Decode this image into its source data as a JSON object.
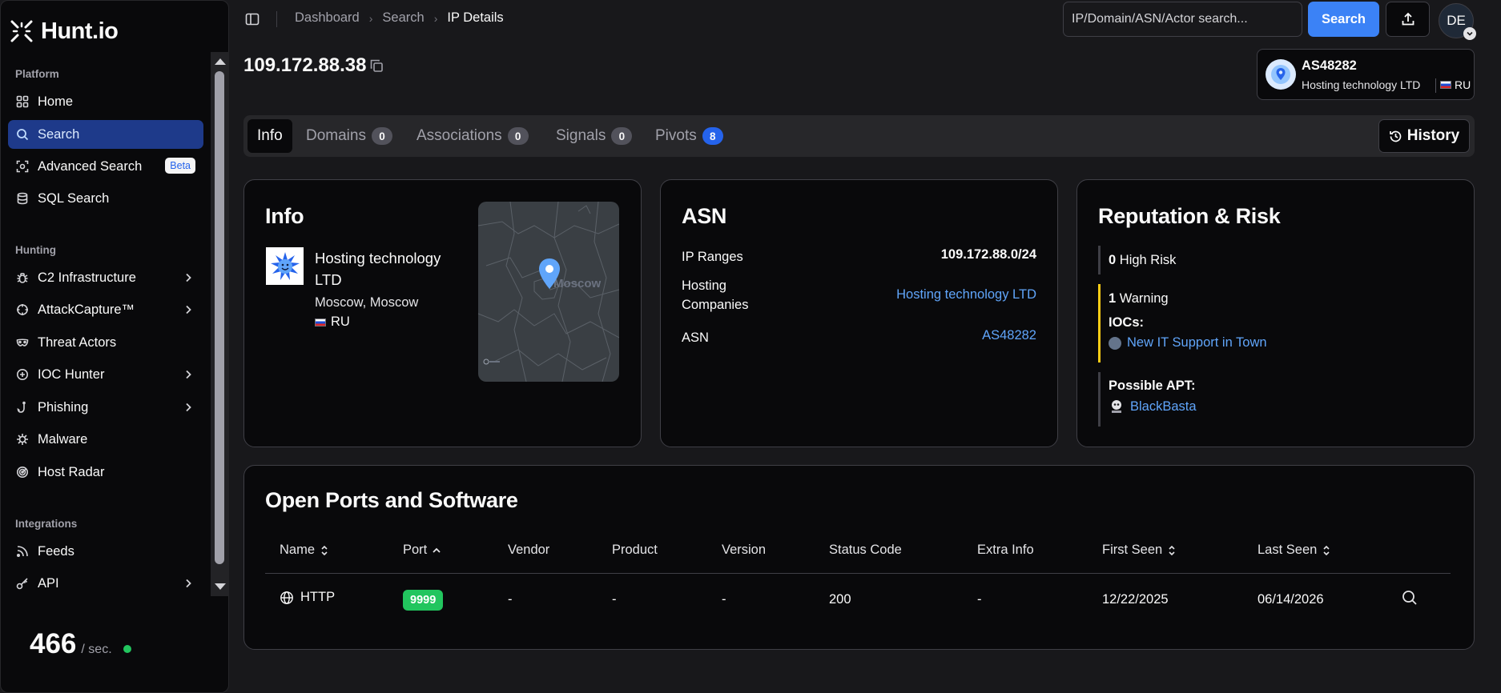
{
  "app": {
    "name": "Hunt.io"
  },
  "sidebar": {
    "sections": [
      {
        "title": "Platform"
      },
      {
        "title": "Hunting"
      },
      {
        "title": "Integrations"
      }
    ],
    "items": [
      {
        "label": "Home"
      },
      {
        "label": "Search"
      },
      {
        "label": "Advanced Search",
        "badge": "Beta"
      },
      {
        "label": "SQL Search"
      },
      {
        "label": "C2 Infrastructure"
      },
      {
        "label": "AttackCapture™"
      },
      {
        "label": "Threat Actors"
      },
      {
        "label": "IOC Hunter"
      },
      {
        "label": "Phishing"
      },
      {
        "label": "Malware"
      },
      {
        "label": "Host Radar"
      },
      {
        "label": "Feeds"
      },
      {
        "label": "API"
      }
    ],
    "rate": {
      "value": "466",
      "unit": "/ sec."
    }
  },
  "breadcrumb": [
    "Dashboard",
    "Search",
    "IP Details"
  ],
  "search": {
    "placeholder": "IP/Domain/ASN/Actor search...",
    "button": "Search"
  },
  "user": {
    "initials": "DE"
  },
  "ip": "109.172.88.38",
  "asn_card": {
    "title": "AS48282",
    "subtitle": "Hosting technology LTD",
    "country": "RU"
  },
  "tabs": [
    {
      "label": "Info"
    },
    {
      "label": "Domains",
      "count": "0"
    },
    {
      "label": "Associations",
      "count": "0"
    },
    {
      "label": "Signals",
      "count": "0"
    },
    {
      "label": "Pivots",
      "count": "8"
    }
  ],
  "history_label": "History",
  "info": {
    "title": "Info",
    "org": "Hosting technology LTD",
    "location": "Moscow, Moscow",
    "country": "RU",
    "map_label": "Moscow"
  },
  "asn": {
    "title": "ASN",
    "rows": [
      {
        "label": "IP Ranges",
        "value": "109.172.88.0/24"
      },
      {
        "label": "Hosting Companies",
        "value": "Hosting technology LTD"
      },
      {
        "label": "ASN",
        "value": "AS48282"
      }
    ]
  },
  "risk": {
    "title": "Reputation & Risk",
    "high_count": "0",
    "high_label": "High Risk",
    "warn_count": "1",
    "warn_label": "Warning",
    "iocs_label": "IOCs:",
    "ioc_link": "New IT Support in Town",
    "apt_label": "Possible APT:",
    "apt_link": "BlackBasta"
  },
  "ports": {
    "title": "Open Ports and Software",
    "headers": [
      "Name",
      "Port",
      "Vendor",
      "Product",
      "Version",
      "Status Code",
      "Extra Info",
      "First Seen",
      "Last Seen"
    ],
    "rows": [
      {
        "name": "HTTP",
        "port": "9999",
        "vendor": "-",
        "product": "-",
        "version": "-",
        "status": "200",
        "extra": "-",
        "first_seen": "12/22/2025",
        "last_seen": "06/14/2026"
      }
    ]
  },
  "colors": {
    "accent": "#3b82f6",
    "active_nav": "#1e3a8a",
    "warning": "#facc15",
    "port_badge": "#22c55e",
    "link": "#60a5fa"
  }
}
